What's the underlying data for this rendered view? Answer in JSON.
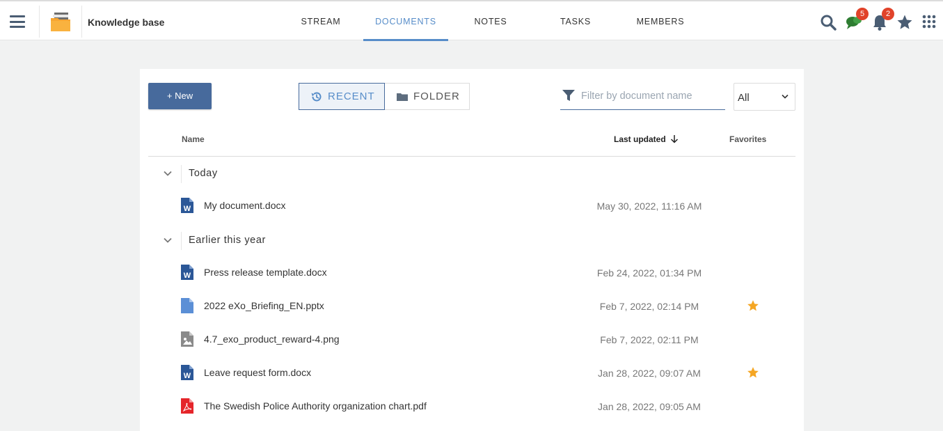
{
  "header": {
    "menu_icon": "hamburger-icon",
    "space_icon": "folder-icon",
    "space_title": "Knowledge base",
    "tabs": [
      {
        "label": "STREAM",
        "active": false
      },
      {
        "label": "DOCUMENTS",
        "active": true
      },
      {
        "label": "NOTES",
        "active": false
      },
      {
        "label": "TASKS",
        "active": false
      },
      {
        "label": "MEMBERS",
        "active": false
      }
    ],
    "icons": {
      "search": "search-icon",
      "chat": "chat-icon",
      "chat_badge": "5",
      "notifications": "bell-icon",
      "notifications_badge": "2",
      "favorites": "star-icon",
      "apps": "apps-grid-icon"
    }
  },
  "toolbar": {
    "new_label": "+ New",
    "view_recent": "RECENT",
    "view_folder": "FOLDER",
    "active_view": "RECENT",
    "filter_placeholder": "Filter by document name",
    "filter_value": "",
    "type_select": "All"
  },
  "table": {
    "col_name": "Name",
    "col_updated": "Last updated",
    "sort_direction": "desc",
    "col_favorites": "Favorites"
  },
  "groups": [
    {
      "label": "Today",
      "documents": [
        {
          "name": "My document.docx",
          "updated": "May 30, 2022, 11:16 AM",
          "type": "word",
          "favorite": false
        }
      ]
    },
    {
      "label": "Earlier this year",
      "documents": [
        {
          "name": "Press release template.docx",
          "updated": "Feb 24, 2022, 01:34 PM",
          "type": "word",
          "favorite": false
        },
        {
          "name": "2022 eXo_Briefing_EN.pptx",
          "updated": "Feb 7, 2022, 02:14 PM",
          "type": "generic",
          "favorite": true
        },
        {
          "name": "4.7_exo_product_reward-4.png",
          "updated": "Feb 7, 2022, 02:11 PM",
          "type": "image",
          "favorite": false
        },
        {
          "name": "Leave request form.docx",
          "updated": "Jan 28, 2022, 09:07 AM",
          "type": "word",
          "favorite": true
        },
        {
          "name": "The Swedish Police Authority organization chart.pdf",
          "updated": "Jan 28, 2022, 09:05 AM",
          "type": "pdf",
          "favorite": false
        }
      ]
    }
  ],
  "colors": {
    "accent": "#578dc9",
    "primary_button": "#476a9c",
    "badge": "#e1432a",
    "favorite_star": "#f5a623",
    "word_icon": "#2b5797",
    "pdf_icon": "#e5252a"
  }
}
